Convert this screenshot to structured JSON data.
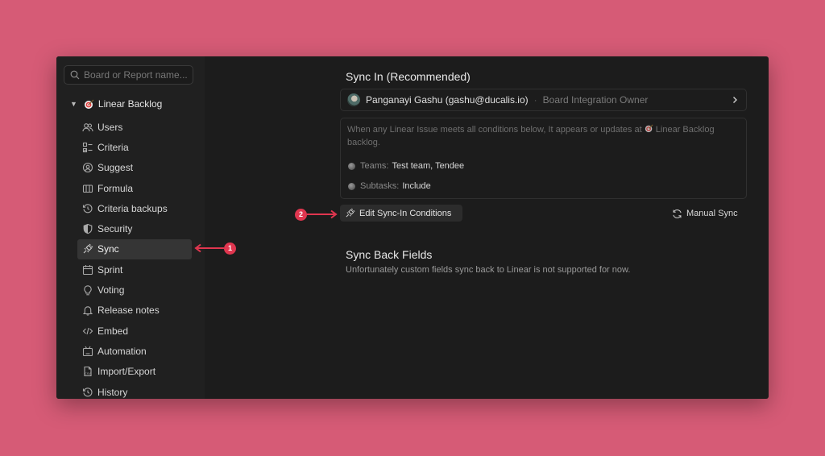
{
  "search": {
    "placeholder": "Board or Report name..."
  },
  "board": {
    "name": "Linear Backlog"
  },
  "sidebar": {
    "items": [
      {
        "label": "Users",
        "icon": "users-icon"
      },
      {
        "label": "Criteria",
        "icon": "criteria-icon"
      },
      {
        "label": "Suggest",
        "icon": "suggest-icon"
      },
      {
        "label": "Formula",
        "icon": "formula-icon"
      },
      {
        "label": "Criteria backups",
        "icon": "history-icon"
      },
      {
        "label": "Security",
        "icon": "shield-icon"
      },
      {
        "label": "Sync",
        "icon": "plug-icon",
        "active": true
      },
      {
        "label": "Sprint",
        "icon": "calendar-icon"
      },
      {
        "label": "Voting",
        "icon": "bulb-icon"
      },
      {
        "label": "Release notes",
        "icon": "bell-icon"
      },
      {
        "label": "Embed",
        "icon": "code-icon"
      },
      {
        "label": "Automation",
        "icon": "robot-icon"
      },
      {
        "label": "Import/Export",
        "icon": "csv-file-icon"
      },
      {
        "label": "History",
        "icon": "history-icon"
      }
    ]
  },
  "sync_in": {
    "heading": "Sync In (Recommended)",
    "owner_name": "Panganayi Gashu (gashu@ducalis.io)",
    "owner_separator": "·",
    "owner_role": "Board Integration Owner",
    "description_before": "When any Linear Issue meets all conditions below, It appears or updates at",
    "description_board": "Linear Backlog",
    "description_after": "backlog.",
    "teams_label": "Teams:",
    "teams_value": "Test team, Tendee",
    "subtasks_label": "Subtasks:",
    "subtasks_value": "Include",
    "edit_button": "Edit Sync-In Conditions",
    "manual_sync": "Manual Sync"
  },
  "sync_back": {
    "heading": "Sync Back Fields",
    "description": "Unfortunately custom fields sync back to Linear is not supported for now."
  },
  "annotations": {
    "step1": "1",
    "step2": "2"
  },
  "colors": {
    "background": "#d65b76",
    "window": "#1c1c1c",
    "sidebar": "#202020",
    "active_item": "#353535",
    "badge": "#e0364f"
  }
}
